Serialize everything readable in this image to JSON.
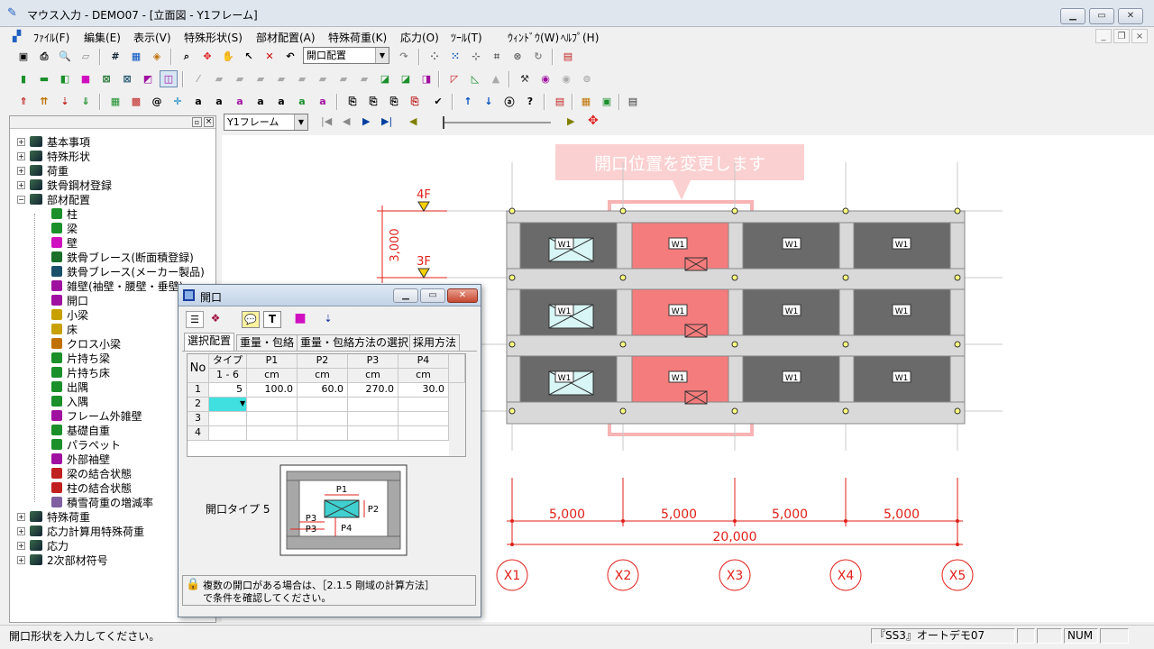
{
  "window": {
    "title": "マウス入力 - DEMO07 - [立面図 - Y1フレーム]"
  },
  "menu": [
    "ﾌｧｲﾙ(F)",
    "編集(E)",
    "表示(V)",
    "特殊形状(S)",
    "部材配置(A)",
    "特殊荷重(K)",
    "応力(O)",
    "ﾂｰﾙ(T)",
    "ｳｨﾝﾄﾞｳ(W)",
    "ﾍﾙﾌﾟ(H)"
  ],
  "toolbar": {
    "mode_select": "開口配置"
  },
  "frame_nav": {
    "frame_select": "Y1フレーム"
  },
  "tree": {
    "items": [
      {
        "label": "基本事項",
        "expander": "+"
      },
      {
        "label": "特殊形状",
        "expander": "+"
      },
      {
        "label": "荷重",
        "expander": "+"
      },
      {
        "label": "鉄骨鋼材登録",
        "expander": "+"
      },
      {
        "label": "部材配置",
        "expander": "−"
      },
      {
        "label": "柱"
      },
      {
        "label": "梁"
      },
      {
        "label": "壁"
      },
      {
        "label": "鉄骨ブレース(断面積登録)"
      },
      {
        "label": "鉄骨ブレース(メーカー製品)"
      },
      {
        "label": "雑壁(袖壁・腰壁・垂壁)"
      },
      {
        "label": "開口"
      },
      {
        "label": "小梁"
      },
      {
        "label": "床"
      },
      {
        "label": "クロス小梁"
      },
      {
        "label": "片持ち梁"
      },
      {
        "label": "片持ち床"
      },
      {
        "label": "出隅"
      },
      {
        "label": "入隅"
      },
      {
        "label": "フレーム外雑壁"
      },
      {
        "label": "基礎自重"
      },
      {
        "label": "パラペット"
      },
      {
        "label": "外部袖壁"
      },
      {
        "label": "梁の結合状態"
      },
      {
        "label": "柱の結合状態"
      },
      {
        "label": "積雪荷重の増減率"
      },
      {
        "label": "特殊荷重",
        "expander": "+"
      },
      {
        "label": "応力計算用特殊荷重",
        "expander": "+"
      },
      {
        "label": "応力",
        "expander": "+"
      },
      {
        "label": "2次部材符号",
        "expander": "+"
      }
    ]
  },
  "drawing": {
    "tooltip": "開口位置を変更します",
    "floor_labels": [
      "4F",
      "3F"
    ],
    "story_height": "3,000",
    "wall_label": "W1",
    "spans": [
      "5,000",
      "5,000",
      "5,000",
      "5,000"
    ],
    "total_span": "20,000",
    "axes": [
      "X1",
      "X2",
      "X3",
      "X4",
      "X5"
    ]
  },
  "dialog": {
    "title": "開口",
    "tabs": [
      "選択配置",
      "重量・包絡",
      "重量・包絡方法の選択",
      "採用方法"
    ],
    "grid": {
      "corner": "No",
      "headers": [
        "タイプ",
        "P1",
        "P2",
        "P3",
        "P4"
      ],
      "subheaders": [
        "1 - 6",
        "cm",
        "cm",
        "cm",
        "cm"
      ],
      "rows": [
        {
          "no": "1",
          "cells": [
            "5",
            "100.0",
            "60.0",
            "270.0",
            "30.0"
          ]
        },
        {
          "no": "2",
          "cells": [
            "",
            "",
            "",
            "",
            ""
          ]
        },
        {
          "no": "3",
          "cells": [
            "",
            "",
            "",
            "",
            ""
          ]
        },
        {
          "no": "4",
          "cells": [
            "",
            "",
            "",
            "",
            ""
          ]
        }
      ]
    },
    "type_label": "開口タイプ 5",
    "diagram_labels": {
      "p1": "P1",
      "p2": "P2",
      "p3a": "P3",
      "p3b": "P3",
      "p4": "P4"
    },
    "note_line1": "複数の開口がある場合は、［2.1.5 剛域の計算方法］",
    "note_line2": "で条件を確認してください。"
  },
  "status": {
    "message": "開口形状を入力してください。",
    "project": "『SS3』オートデモ07",
    "num": "NUM"
  },
  "colors": {
    "opening_highlight": "#f47c7c",
    "wall_dark": "#6a6a6a",
    "dimension_red": "#e0201a",
    "tooltip_bg": "#fbd0d0",
    "selected_cell": "#40e0e0"
  }
}
